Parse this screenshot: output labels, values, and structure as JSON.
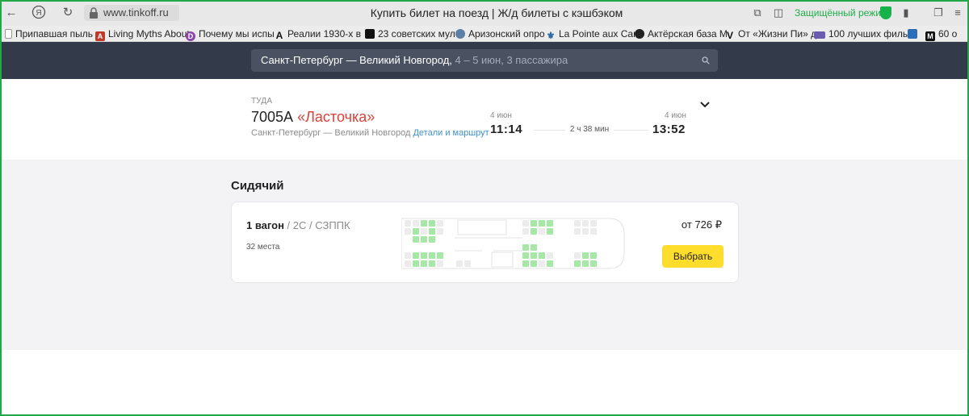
{
  "browser": {
    "url": "www.tinkoff.ru",
    "title": "Купить билет на поезд | Ж/д билеты с кэшбэком",
    "secure_mode": "Защищённый режим"
  },
  "bookmarks": [
    {
      "label": "Припавшая пыль",
      "icon": "page-icon",
      "color": "#9a9a9a"
    },
    {
      "label": "Living Myths About",
      "icon": "letter-a-icon",
      "color": "#c0392b"
    },
    {
      "label": "Почему мы испы",
      "icon": "letter-d-icon",
      "color": "#8e44ad"
    },
    {
      "label": "Реалии 1930-х в",
      "icon": "letter-a-black-icon",
      "color": "#111111"
    },
    {
      "label": "23 советских мул",
      "icon": "square-icon",
      "color": "#111111"
    },
    {
      "label": "Аризонский опро",
      "icon": "globe-icon",
      "color": "#5b7fa6"
    },
    {
      "label": "La Pointe aux Can",
      "icon": "fleur-icon",
      "color": "#2c6aa0"
    },
    {
      "label": "Актёрская база М",
      "icon": "camera-icon",
      "color": "#222222"
    },
    {
      "label": "От «Жизни Пи» д",
      "icon": "letter-v-icon",
      "color": "#111111"
    },
    {
      "label": "100 лучших филь",
      "icon": "film-icon",
      "color": "#6b5cb0"
    },
    {
      "label": "",
      "icon": "doc-icon",
      "color": "#2d6db5"
    },
    {
      "label": "60 о",
      "icon": "letter-m-icon",
      "color": "#111111"
    }
  ],
  "search": {
    "route": "Санкт-Петербург — Великий Новгород,",
    "meta": " 4 – 5 июн, 3 пассажира"
  },
  "trip": {
    "direction": "ТУДА",
    "train_number": "7005А",
    "train_name": "«Ласточка»",
    "route": "Санкт-Петербург — Великий Новгород",
    "details_link": "Детали и маршрут",
    "departure_date": "4 июн",
    "departure_time": "11:14",
    "duration": "2 ч 38 мин",
    "arrival_date": "4 июн",
    "arrival_time": "13:52"
  },
  "section": {
    "title": "Сидячий"
  },
  "car": {
    "number": "1 вагон",
    "class": " / 2С / СЗППК",
    "seats_left": "32 места",
    "price": "от 726 ₽",
    "button": "Выбрать"
  },
  "colors": {
    "accent": "#ffdd2d",
    "train_name": "#e0403a",
    "link": "#3f8fd6",
    "seat_free": "#a6e8a6",
    "seat_taken": "#ececec",
    "hero": "#333b4a",
    "frame": "#22a846"
  }
}
